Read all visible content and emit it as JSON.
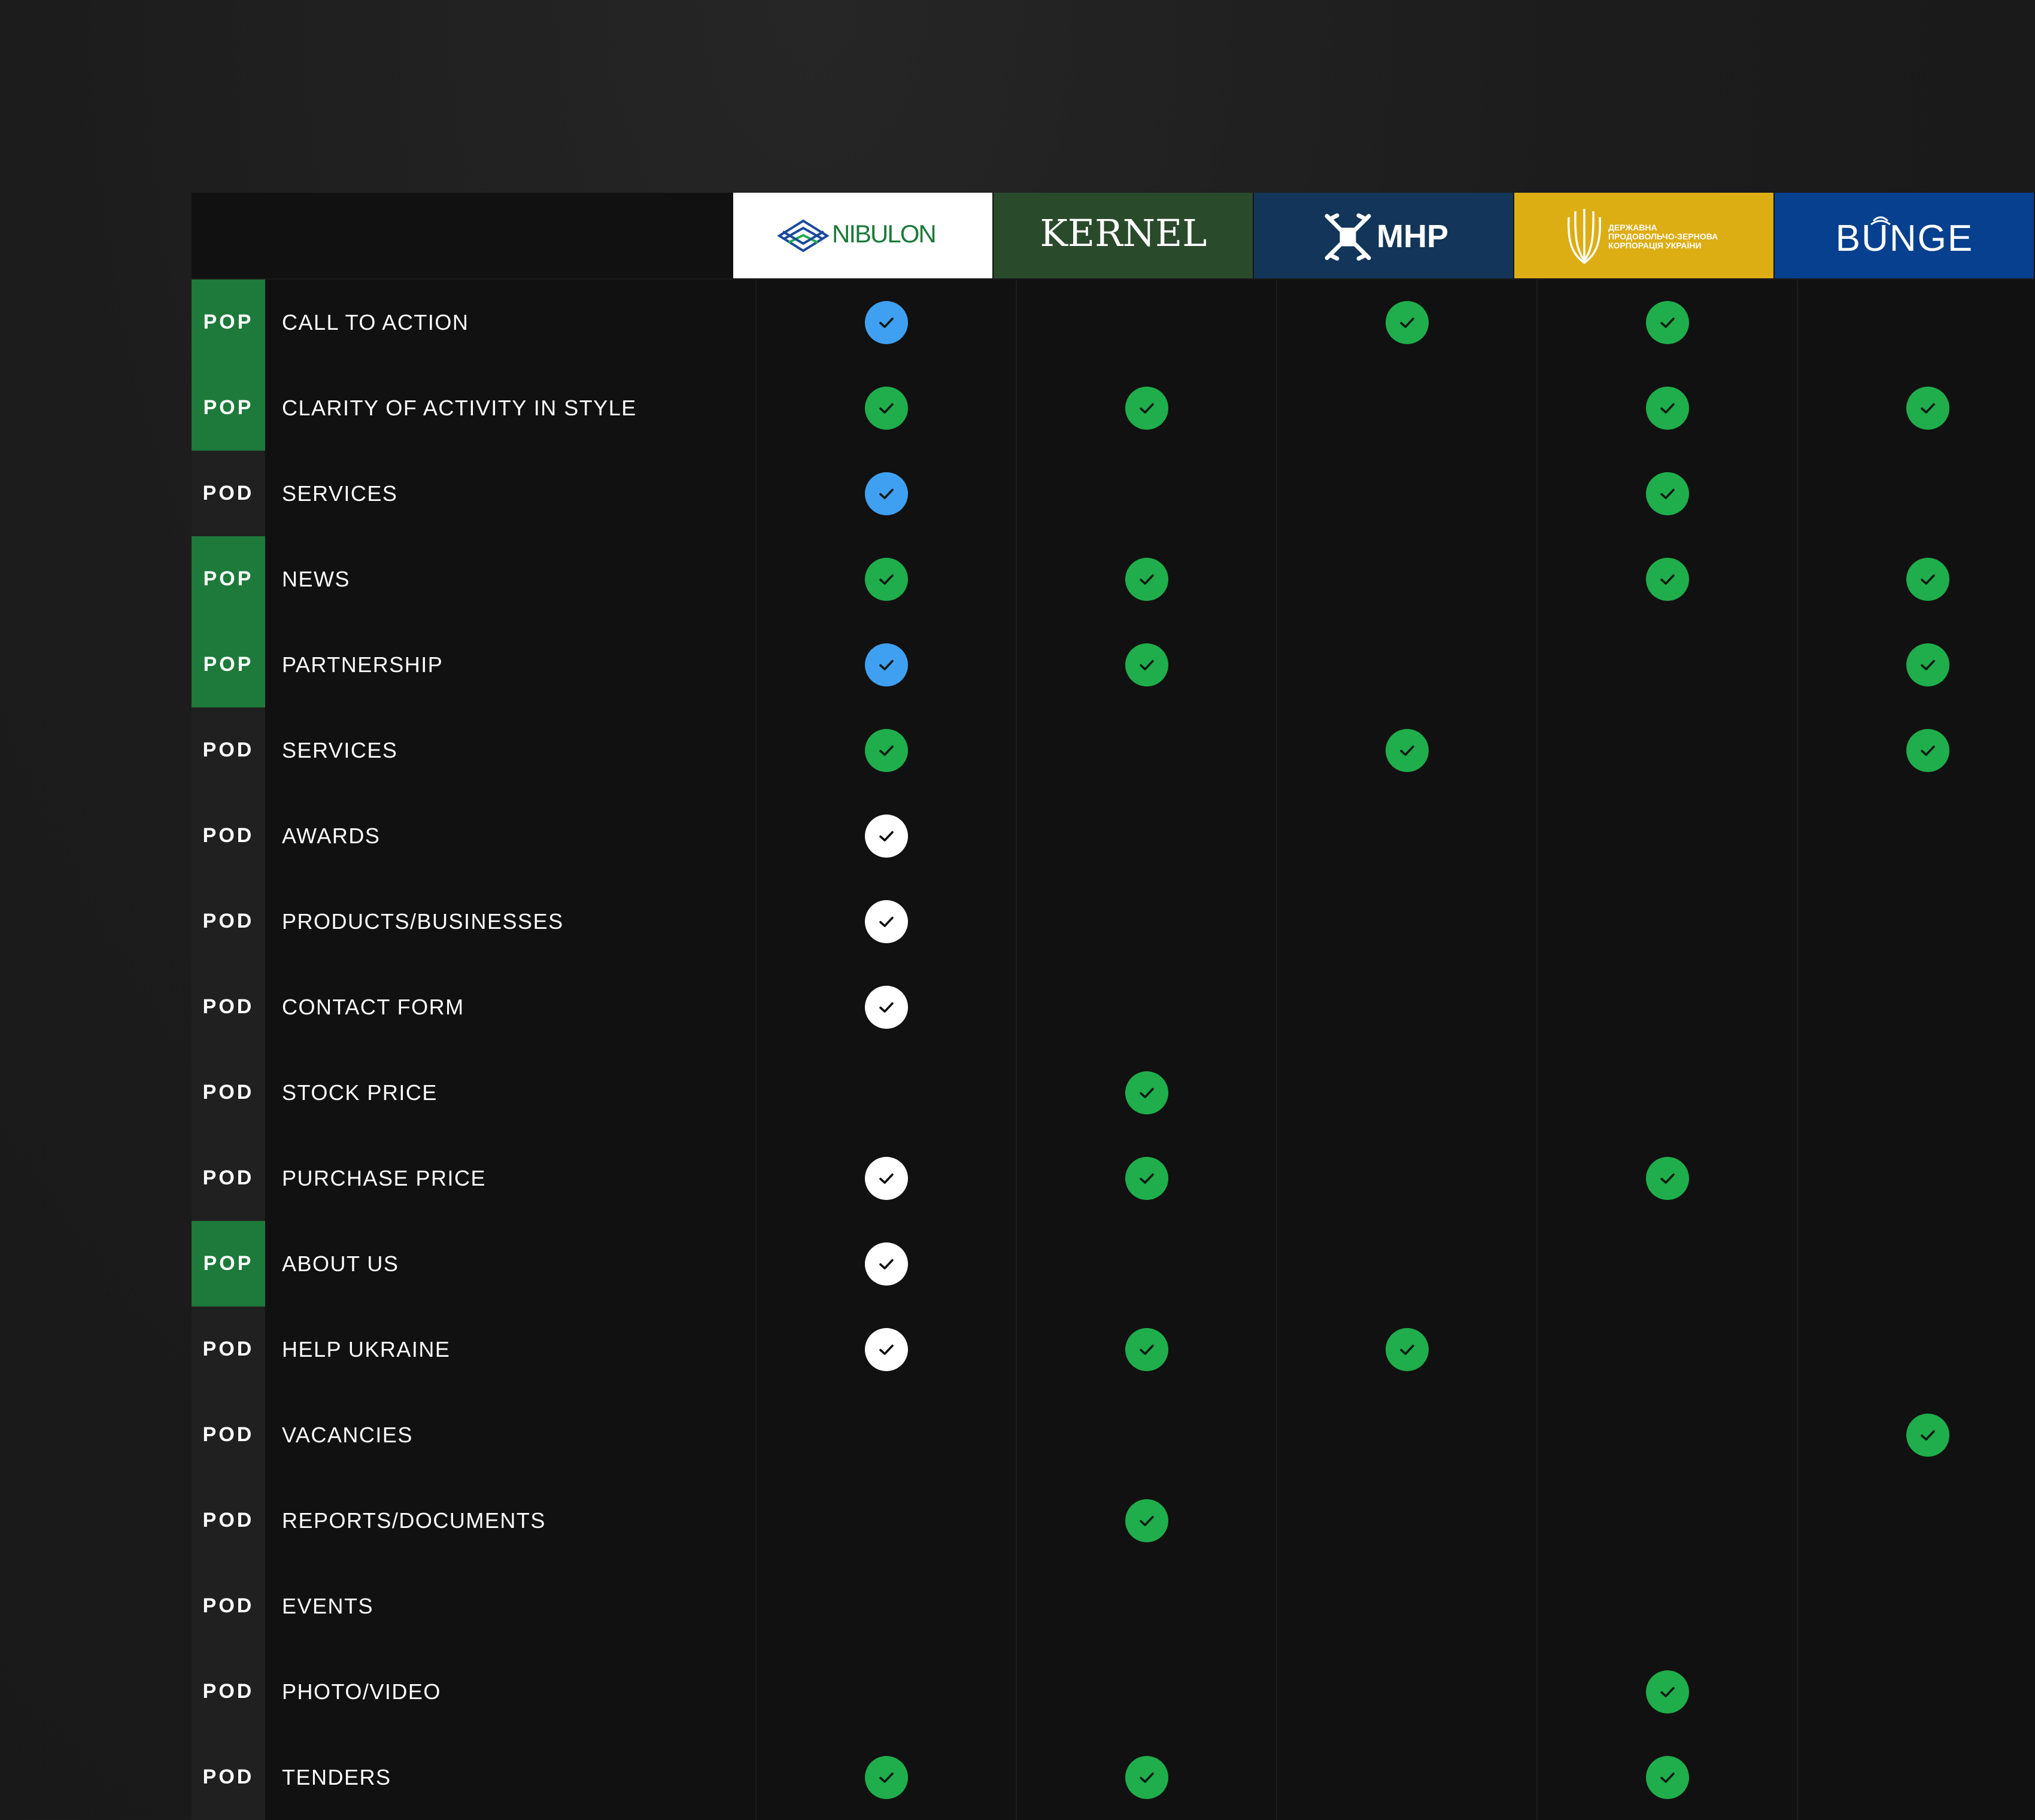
{
  "colors": {
    "background": "#1c1c1c",
    "table": "#111111",
    "pop_tag": "#1d7a3a",
    "pod_tag": "#202020",
    "check_green": "#1fae4b",
    "check_blue": "#3fa0f2",
    "check_white": "#ffffff"
  },
  "brands": [
    {
      "name": "NIBULON",
      "bg": "#ffffff",
      "fg": "#1a4a9c",
      "icon": "nibulon-logo-icon"
    },
    {
      "name": "KERNEL",
      "bg": "#2a4a2c",
      "fg": "#ffffff",
      "icon": "kernel-logo"
    },
    {
      "name": "MHP",
      "bg": "#123559",
      "fg": "#ffffff",
      "icon": "windmill-logo-icon"
    },
    {
      "name": "ДЕРЖАВНА ПРОДОВОЛЬЧО-ЗЕРНОВА КОРПОРАЦІЯ УКРАЇНИ",
      "bg": "#ddad14",
      "fg": "#ffffff",
      "icon": "wheat-trident-logo-icon"
    },
    {
      "name": "BUNGE",
      "bg": "#07408e",
      "fg": "#ffffff",
      "icon": "bunge-logo"
    }
  ],
  "rows": [
    {
      "tag": "POP",
      "label": "CALL TO ACTION",
      "cells": [
        "blue",
        "",
        "green",
        "green",
        ""
      ]
    },
    {
      "tag": "POP",
      "label": "CLARITY OF ACTIVITY IN STYLE",
      "cells": [
        "green",
        "green",
        "",
        "green",
        "green"
      ]
    },
    {
      "tag": "POD",
      "label": "SERVICES",
      "cells": [
        "blue",
        "",
        "",
        "green",
        ""
      ]
    },
    {
      "tag": "POP",
      "label": "NEWS",
      "cells": [
        "green",
        "green",
        "",
        "green",
        "green"
      ]
    },
    {
      "tag": "POP",
      "label": "PARTNERSHIP",
      "cells": [
        "blue",
        "green",
        "",
        "",
        "green"
      ]
    },
    {
      "tag": "POD",
      "label": "SERVICES",
      "cells": [
        "green",
        "",
        "green",
        "",
        "green"
      ]
    },
    {
      "tag": "POD",
      "label": "AWARDS",
      "cells": [
        "white",
        "",
        "",
        "",
        ""
      ]
    },
    {
      "tag": "POD",
      "label": "PRODUCTS/BUSINESSES",
      "cells": [
        "white",
        "",
        "",
        "",
        ""
      ]
    },
    {
      "tag": "POD",
      "label": "CONTACT FORM",
      "cells": [
        "white",
        "",
        "",
        "",
        ""
      ]
    },
    {
      "tag": "POD",
      "label": "STOCK PRICE",
      "cells": [
        "",
        "green",
        "",
        "",
        ""
      ]
    },
    {
      "tag": "POD",
      "label": "PURCHASE PRICE",
      "cells": [
        "white",
        "green",
        "",
        "green",
        ""
      ]
    },
    {
      "tag": "POP",
      "label": "ABOUT US",
      "cells": [
        "white",
        "",
        "",
        "",
        ""
      ]
    },
    {
      "tag": "POD",
      "label": "HELP UKRAINE",
      "cells": [
        "white",
        "green",
        "green",
        "",
        ""
      ]
    },
    {
      "tag": "POD",
      "label": "VACANCIES",
      "cells": [
        "",
        "",
        "",
        "",
        "green"
      ]
    },
    {
      "tag": "POD",
      "label": "REPORTS/DOCUMENTS",
      "cells": [
        "",
        "green",
        "",
        "",
        ""
      ]
    },
    {
      "tag": "POD",
      "label": "EVENTS",
      "cells": [
        "",
        "",
        "",
        "",
        ""
      ]
    },
    {
      "tag": "POD",
      "label": "PHOTO/VIDEO",
      "cells": [
        "",
        "",
        "",
        "green",
        ""
      ]
    },
    {
      "tag": "POD",
      "label": "TENDERS",
      "cells": [
        "green",
        "green",
        "",
        "green",
        ""
      ]
    }
  ]
}
